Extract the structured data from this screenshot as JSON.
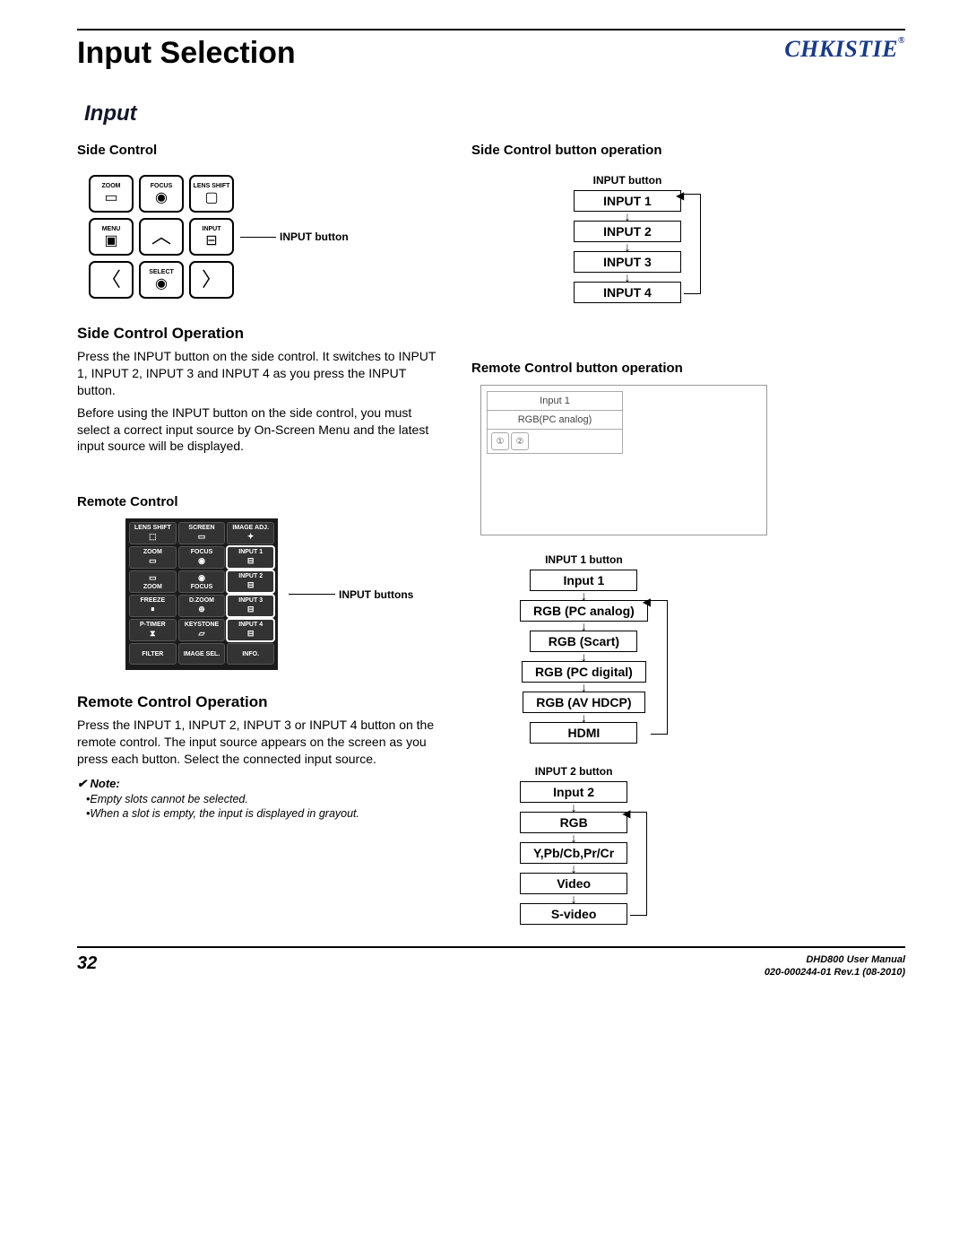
{
  "section_title": "Input Selection",
  "brand": "CHKISTIE",
  "sub_title": "Input",
  "left": {
    "side_control_hdr": "Side Control",
    "panel_buttons": {
      "zoom": "ZOOM",
      "focus": "FOCUS",
      "lens_shift": "LENS SHIFT",
      "menu": "MENU",
      "input": "INPUT",
      "select": "SELECT"
    },
    "input_button_callout": "INPUT button",
    "side_op_hdr": "Side Control Operation",
    "side_op_p1": "Press the INPUT button on the side control. It switches to INPUT 1, INPUT 2, INPUT 3 and INPUT 4 as you press the INPUT button.",
    "side_op_p2": "Before using the INPUT button on the side control, you must select a correct input source by On-Screen Menu and the latest input source will be displayed.",
    "remote_hdr": "Remote Control",
    "remote_buttons": {
      "row1": [
        "LENS SHIFT",
        "SCREEN",
        "IMAGE ADJ."
      ],
      "row2": [
        "ZOOM",
        "FOCUS",
        "INPUT 1"
      ],
      "row3": [
        "ZOOM",
        "FOCUS",
        "INPUT 2"
      ],
      "row4": [
        "FREEZE",
        "D.ZOOM",
        "INPUT 3"
      ],
      "row5": [
        "P-TIMER",
        "KEYSTONE",
        "INPUT 4"
      ],
      "row6": [
        "FILTER",
        "IMAGE SEL.",
        "INFO."
      ]
    },
    "input_buttons_callout": "INPUT buttons",
    "remote_op_hdr": "Remote Control Operation",
    "remote_op_p1": "Press the INPUT 1, INPUT 2, INPUT 3 or INPUT 4 button on the remote control. The input source appears on the screen as you press each button. Select the connected input source.",
    "note_hdr": "✔ Note:",
    "note1": "•Empty slots cannot be selected.",
    "note2": "•When a slot is empty, the input is displayed in grayout."
  },
  "right": {
    "side_btn_op_hdr": "Side Control button operation",
    "input_btn_label": "INPUT button",
    "input_cycle": [
      "INPUT 1",
      "INPUT 2",
      "INPUT 3",
      "INPUT 4"
    ],
    "remote_btn_op_hdr": "Remote Control button operation",
    "osd": {
      "line1": "Input 1",
      "line2": "RGB(PC analog)"
    },
    "input1_label": "INPUT 1 button",
    "input1_top": "Input 1",
    "input1_cycle": [
      "RGB (PC analog)",
      "RGB (Scart)",
      "RGB (PC digital)",
      "RGB (AV HDCP)",
      "HDMI"
    ],
    "input2_label": "INPUT 2 button",
    "input2_top": "Input 2",
    "input2_cycle": [
      "RGB",
      "Y,Pb/Cb,Pr/Cr",
      "Video",
      "S-video"
    ]
  },
  "footer": {
    "page": "32",
    "doc1": "DHD800 User Manual",
    "doc2": "020-000244-01 Rev.1 (08-2010)"
  }
}
